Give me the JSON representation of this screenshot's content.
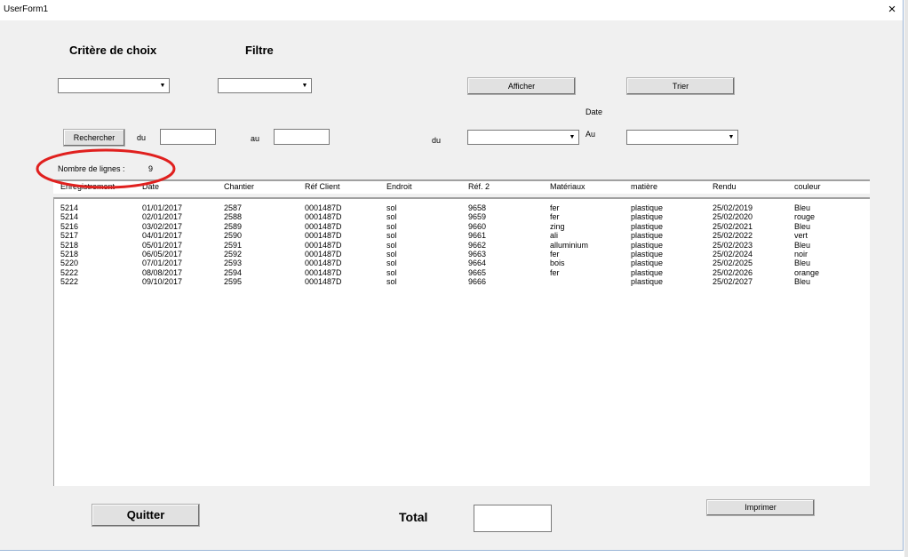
{
  "window": {
    "title": "UserForm1",
    "close_icon": "×"
  },
  "labels": {
    "critere": "Critère de choix",
    "filtre": "Filtre",
    "date": "Date",
    "du1": "du",
    "au1": "au",
    "du2": "du",
    "au2": "Au",
    "nombre": "Nombre de lignes :",
    "nombre_value": "9",
    "total": "Total"
  },
  "buttons": {
    "afficher": "Afficher",
    "trier": "Trier",
    "rechercher": "Rechercher",
    "quitter": "Quitter",
    "imprimer": "Imprimer"
  },
  "inputs": {
    "critere": "",
    "filtre": "",
    "du_text": "",
    "au_text": "",
    "du_date": "",
    "au_date": "",
    "total": ""
  },
  "table": {
    "columns": [
      "Enregistrement",
      "Date",
      "Chantier",
      "Réf Client",
      "Endroit",
      "Réf. 2",
      "Matériaux",
      "matière",
      "Rendu",
      "couleur"
    ],
    "rows": [
      [
        "5214",
        "01/01/2017",
        "2587",
        "0001487D",
        "sol",
        "9658",
        "fer",
        "plastique",
        "25/02/2019",
        "Bleu"
      ],
      [
        "5214",
        "02/01/2017",
        "2588",
        "0001487D",
        "sol",
        "9659",
        "fer",
        "plastique",
        "25/02/2020",
        "rouge"
      ],
      [
        "5216",
        "03/02/2017",
        "2589",
        "0001487D",
        "sol",
        "9660",
        "zing",
        "plastique",
        "25/02/2021",
        "Bleu"
      ],
      [
        "5217",
        "04/01/2017",
        "2590",
        "0001487D",
        "sol",
        "9661",
        "ali",
        "plastique",
        "25/02/2022",
        "vert"
      ],
      [
        "5218",
        "05/01/2017",
        "2591",
        "0001487D",
        "sol",
        "9662",
        "alluminium",
        "plastique",
        "25/02/2023",
        "Bleu"
      ],
      [
        "5218",
        "06/05/2017",
        "2592",
        "0001487D",
        "sol",
        "9663",
        "fer",
        "plastique",
        "25/02/2024",
        "noir"
      ],
      [
        "5220",
        "07/01/2017",
        "2593",
        "0001487D",
        "sol",
        "9664",
        "bois",
        "plastique",
        "25/02/2025",
        "Bleu"
      ],
      [
        "5222",
        "08/08/2017",
        "2594",
        "0001487D",
        "sol",
        "9665",
        "fer",
        "plastique",
        "25/02/2026",
        "orange"
      ],
      [
        "5222",
        "09/10/2017",
        "2595",
        "0001487D",
        "sol",
        "9666",
        "",
        "plastique",
        "25/02/2027",
        "Bleu"
      ]
    ]
  },
  "colors": {
    "annotation": "#e0201e"
  }
}
